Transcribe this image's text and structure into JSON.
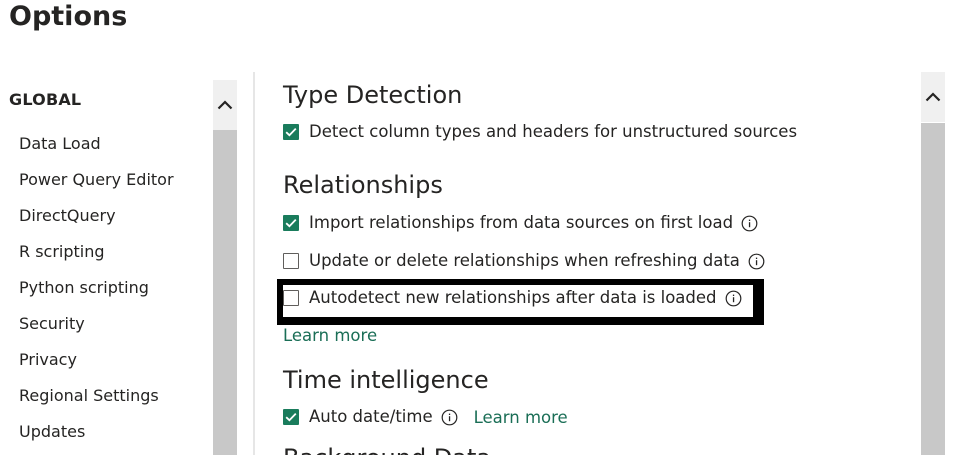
{
  "dialog": {
    "title": "Options"
  },
  "nav": {
    "section_label": "GLOBAL",
    "items": [
      {
        "label": "Data Load"
      },
      {
        "label": "Power Query Editor"
      },
      {
        "label": "DirectQuery"
      },
      {
        "label": "R scripting"
      },
      {
        "label": "Python scripting"
      },
      {
        "label": "Security"
      },
      {
        "label": "Privacy"
      },
      {
        "label": "Regional Settings"
      },
      {
        "label": "Updates"
      }
    ]
  },
  "sections": {
    "type_detection": {
      "heading": "Type Detection",
      "options": [
        {
          "label": "Detect column types and headers for unstructured sources",
          "checked": true
        }
      ]
    },
    "relationships": {
      "heading": "Relationships",
      "options": [
        {
          "label": "Import relationships from data sources on first load",
          "checked": true
        },
        {
          "label": "Update or delete relationships when refreshing data",
          "checked": false
        },
        {
          "label": "Autodetect new relationships after data is loaded",
          "checked": false
        }
      ],
      "learn_more": "Learn more"
    },
    "time_intelligence": {
      "heading": "Time intelligence",
      "options": [
        {
          "label": "Auto date/time",
          "checked": true
        }
      ],
      "learn_more": "Learn more"
    },
    "next_heading": "Background Data"
  },
  "icons": {
    "info": "info-icon",
    "scroll_up": "chevron-up-icon",
    "checkmark": "checkmark-icon"
  },
  "colors": {
    "accent": "#1a7c5c",
    "link": "#1a6e56",
    "highlight": "#000000"
  }
}
